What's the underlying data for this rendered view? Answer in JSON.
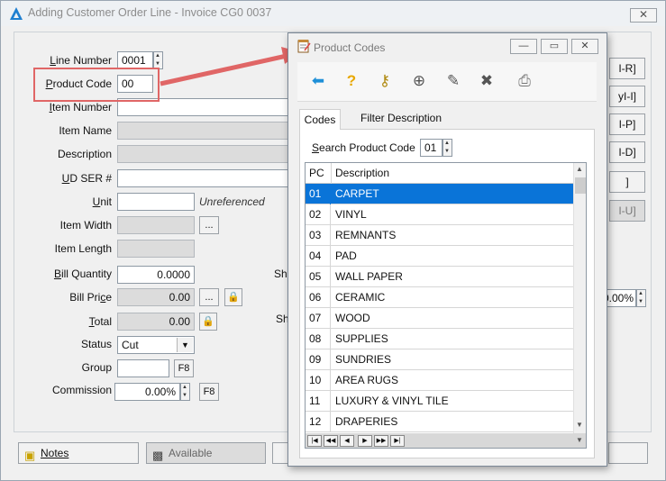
{
  "main": {
    "title": "Adding Customer Order Line - Invoice CG0 0037",
    "close_glyph": "✕"
  },
  "form": {
    "line_number_label": "Line Number",
    "line_number_value": "0001",
    "product_code_label": "Product Code",
    "product_code_value": "00",
    "item_number_label": "Item Number",
    "item_name_label": "Item Name",
    "description_label": "Description",
    "ud_ser_label": "UD SER #",
    "unit_label": "Unit",
    "unit_note": "Unreferenced",
    "item_width_label": "Item Width",
    "item_length_label": "Item Length",
    "bill_quantity_label": "Bill Quantity",
    "bill_quantity_value": "0.0000",
    "bill_price_label": "Bill Price",
    "bill_price_value": "0.00",
    "total_label": "Total",
    "total_value": "0.00",
    "status_label": "Status",
    "status_value": "Cut",
    "group_label": "Group",
    "commission_label": "Commission",
    "commission_value": "0.00%",
    "f8_label": "F8",
    "ellipsis_label": "...",
    "partial_ship_label_1": "Shi",
    "partial_ship_label_2": "Sh",
    "right_percent_value": "0.00%"
  },
  "right_buttons": [
    "I-R]",
    "yI-I]",
    "I-P]",
    "I-D]",
    "]",
    "I-U]"
  ],
  "bottom": {
    "notes_label": "Notes",
    "available_label": "Available"
  },
  "dialog": {
    "title": "Product Codes",
    "minimize_glyph": "—",
    "maximize_glyph": "▭",
    "close_glyph": "✕",
    "toolbar_icons": [
      "back-arrow-icon",
      "help-icon",
      "key-icon",
      "new-record-icon",
      "edit-record-icon",
      "delete-record-icon",
      "print-icon"
    ],
    "toolbar_glyphs": [
      "⬅",
      "?",
      "⚷",
      "⊕",
      "✎",
      "✖",
      "⎙"
    ],
    "tabs": [
      "Codes",
      "Filter Description"
    ],
    "search_label": "Search Product Code",
    "search_value": "01",
    "columns": [
      "PC",
      "Description"
    ],
    "rows": [
      {
        "pc": "01",
        "desc": "CARPET"
      },
      {
        "pc": "02",
        "desc": "VINYL"
      },
      {
        "pc": "03",
        "desc": "REMNANTS"
      },
      {
        "pc": "04",
        "desc": "PAD"
      },
      {
        "pc": "05",
        "desc": "WALL PAPER"
      },
      {
        "pc": "06",
        "desc": "CERAMIC"
      },
      {
        "pc": "07",
        "desc": "WOOD"
      },
      {
        "pc": "08",
        "desc": "SUPPLIES"
      },
      {
        "pc": "09",
        "desc": "SUNDRIES"
      },
      {
        "pc": "10",
        "desc": "AREA RUGS"
      },
      {
        "pc": "11",
        "desc": "LUXURY & VINYL TILE"
      },
      {
        "pc": "12",
        "desc": "DRAPERIES"
      }
    ],
    "selected_index": 0,
    "nav_glyphs": [
      "|◀",
      "◀◀",
      "◀",
      "▶",
      "▶▶",
      "▶|"
    ]
  },
  "colors": {
    "selection": "#0a74d8",
    "annotation": "#e06666",
    "toolbar_back": "#1e8fd8",
    "toolbar_help": "#e8a800"
  }
}
